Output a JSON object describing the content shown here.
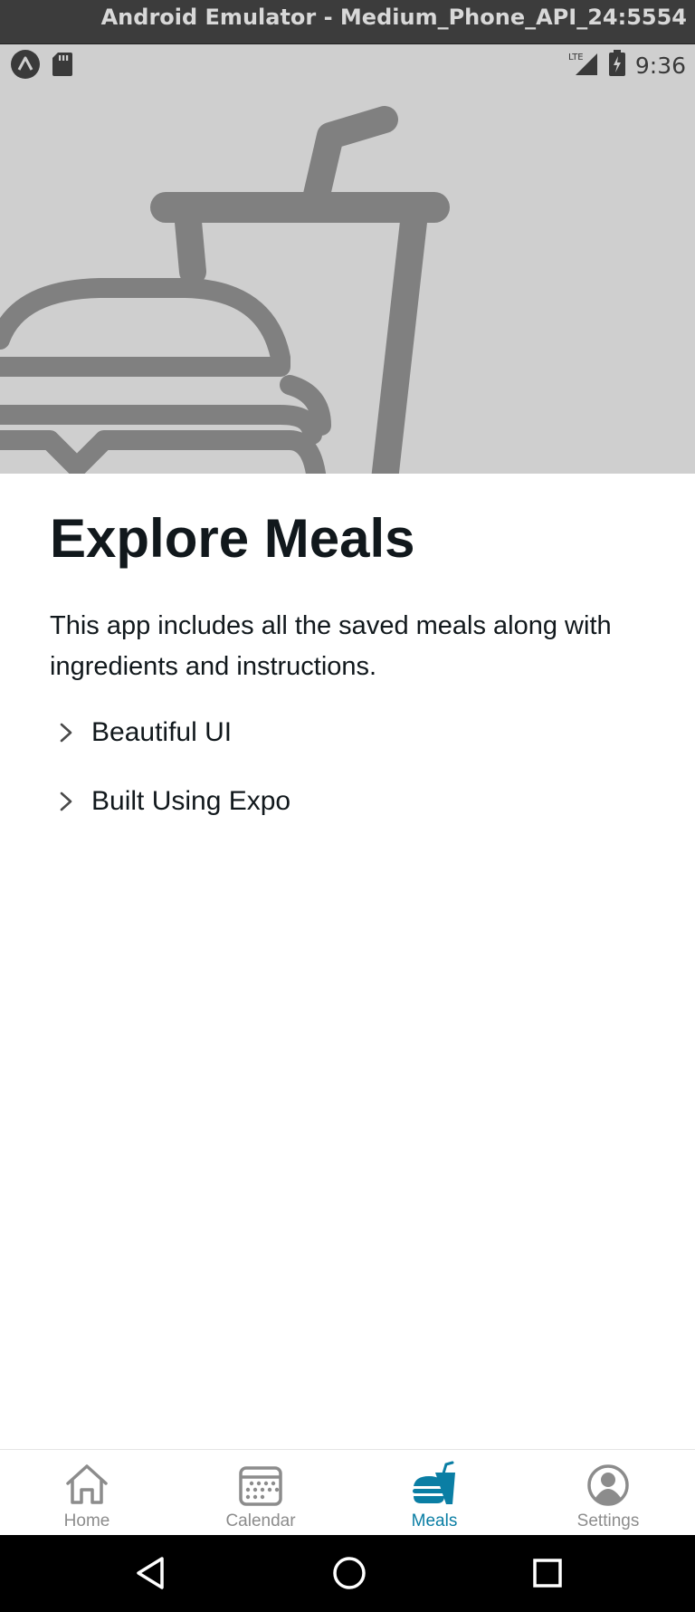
{
  "window": {
    "title": "Android Emulator - Medium_Phone_API_24:5554"
  },
  "status_bar": {
    "time": "9:36",
    "network": "LTE"
  },
  "main": {
    "title": "Explore Meals",
    "description": "This app includes all the saved meals along with ingredients and instructions.",
    "collapsibles": [
      {
        "label": "Beautiful UI",
        "icon": "chevron-right-icon"
      },
      {
        "label": "Built Using Expo",
        "icon": "chevron-right-icon"
      }
    ]
  },
  "tabs": [
    {
      "label": "Home",
      "icon": "house-icon",
      "active": false
    },
    {
      "label": "Calendar",
      "icon": "calendar-icon",
      "active": false
    },
    {
      "label": "Meals",
      "icon": "fast-food-icon",
      "active": true
    },
    {
      "label": "Settings",
      "icon": "user-circle-icon",
      "active": false
    }
  ],
  "colors": {
    "accent": "#0a7ea4",
    "text": "#11181c",
    "inactive_tab": "#8c8c8c",
    "hero_background": "#cfcfcf",
    "hero_icon": "#808080"
  }
}
